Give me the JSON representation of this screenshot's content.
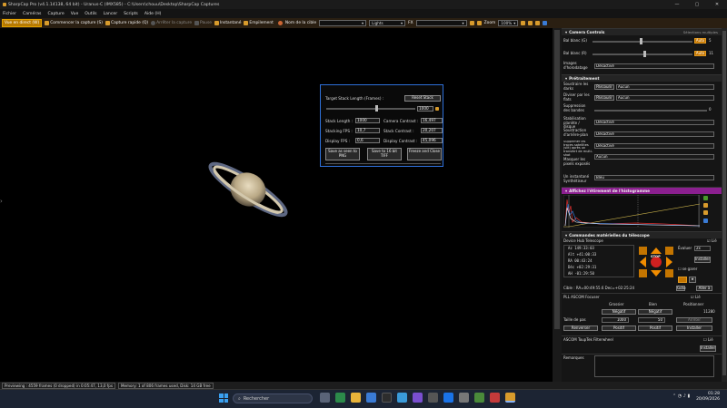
{
  "window": {
    "title": "SharpCap Pro (v4.1.14138, 64 bit) - Uranus-C (IMX585) - C:\\Users\\chouu\\Desktop\\SharpCap Captures",
    "controls": [
      "—",
      "▢",
      "✕"
    ]
  },
  "menu": [
    "Fichier",
    "Caméras",
    "Capture",
    "Vue",
    "Outils",
    "Lancer",
    "Scripts",
    "Aide (H)"
  ],
  "toolbar": {
    "live": "Vue en direct (W)",
    "start_capture": "Commencer la capture (S)",
    "quick_capture": "Capture rapide (Q)",
    "stop_capture": "Arrêter la capture",
    "pause": "Pause",
    "snapshot": "Instantané",
    "stack": "Empilement",
    "target_label": "Nom de la cible",
    "target_value": "",
    "frame_type": "Lights",
    "fx_label": "FX",
    "fx_value": "",
    "zoom_label": "Zoom",
    "zoom_value": "100%"
  },
  "stack_panel": {
    "target_label": "Target Stack Length (Frames) :",
    "reset": "Reset Stack",
    "target_value": "1000",
    "stack_length_label": "Stack Length :",
    "stack_length": "1000",
    "camera_contrast_label": "Camera Contrast :",
    "camera_contrast": "16,497",
    "stacking_fps_label": "Stacking FPS :",
    "stacking_fps": "10,7",
    "stack_contrast_label": "Stack Contrast :",
    "stack_contrast": "20,207",
    "display_fps_label": "Display FPS :",
    "display_fps": "0,6",
    "display_contrast_label": "Display Contrast :",
    "display_contrast": "45,096",
    "save_png": "Save as seen to PNG",
    "save_tiff": "Save to 16 bit TIFF",
    "freeze": "Freeze and Close"
  },
  "right": {
    "camera_controls": "Camera Controls",
    "multi_choice": "Sélections multiples",
    "wb_blue_label": "Bal blanc (G)",
    "wb_blue_auto": "Auto",
    "wb_blue_value": "5",
    "wb_red_label": "Bal blanc (R)",
    "wb_red_auto": "Auto",
    "wb_red_value": "11",
    "timestamp_label": "Images d'horodatage",
    "timestamp_value": "Désactivé",
    "preprocess": "Prétraitement",
    "dark_label": "Soustraire les darks",
    "dark_browse": "Parcourir",
    "dark_value": "Aucun",
    "flat_label": "Diviser par les flats",
    "flat_browse": "Parcourir",
    "flat_value": "Aucun",
    "banding_label": "Suppression des bandes",
    "banding_value": "0",
    "stabilization_label": "Stabilisation planète / disque",
    "stabilization_value": "Désactivé",
    "background_label": "Soustraction d'arrière-plan",
    "background_value": "Désactivé",
    "trails_label": "Supprimer les traces satellites (slit) après un transfert de multi-shot",
    "trails_value": "Désactivé",
    "hotpix_label": "Masquer les pixels exposés",
    "hotpix_value": "Aucun",
    "synthetic_label": "Un instantané Synthétiseur",
    "synthetic_value": "Bleu",
    "histogram_title": "Affichez l'étirement de l'histogramme",
    "telescope_title": "Commandes matérielles du télescope",
    "mount_label": "Device Hub Telescope",
    "mount_link": "Lié",
    "az": "Az    149:33:03",
    "alt": "Alt   +41:00:33",
    "ra": "RA     00:43:24",
    "dec": "Déc   +02:29:31",
    "ah": "AH    -01:29:50",
    "speed_label": "Évaluer",
    "speed_value": "2x",
    "install": "Installer",
    "guide_label": "se garer",
    "stop": "STOP",
    "cible": "Cible : RA=00:49:55.6 Dec=+02:25:24",
    "goto": "Goto",
    "go_a": "Aller à",
    "focuser_label": "PLL ASCOM Focuser",
    "focuser_link": "Lié",
    "focus_col1": "Grossier",
    "focus_col2": "Bien",
    "focus_col3": "Positionner",
    "focus_n1": "Négatif",
    "focus_n2": "Négatif",
    "focus_pos": "11280",
    "step_label": "Taille de pas",
    "step1": "1000",
    "step2": "50",
    "stop_focus": "Arrêter",
    "reverse": "Renverser",
    "pos1": "Positif",
    "pos2": "Positif",
    "install2": "Installer",
    "filterwheel_label": "ASCOM ToupTek Filterwheel",
    "filterwheel_link": "Lié",
    "install3": "Installer",
    "notes_label": "Remarques"
  },
  "status": {
    "preview": "Previewing : 4559 frames (0 dropped) in 0:05:47, 13,0 fps",
    "memory": "Memory: 1 of 806 frames used, Disk: 14 GB free"
  },
  "taskbar": {
    "search": "Rechercher",
    "time": "01:28",
    "date": "20/09/2026"
  },
  "colors": {
    "accent_orange": "#c47500",
    "panel_border": "#2e6fd8",
    "histogram_header": "#8b1f8f"
  }
}
